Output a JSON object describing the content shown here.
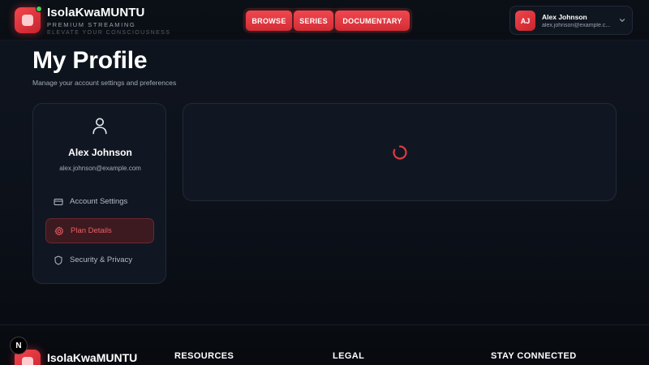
{
  "header": {
    "brand_name": "IsolaKwaMUNTU",
    "tagline_primary": "PREMIUM STREAMING",
    "tagline_secondary": "ELEVATE YOUR CONSCIOUSNESS",
    "status_dot_color": "#39d353",
    "nav": [
      {
        "label": "BROWSE"
      },
      {
        "label": "SERIES"
      },
      {
        "label": "DOCUMENTARY"
      }
    ],
    "user": {
      "initials": "AJ",
      "name": "Alex Johnson",
      "email": "alex.johnson@example.c..."
    }
  },
  "page": {
    "title": "My Profile",
    "subtitle": "Manage your account settings and preferences"
  },
  "sidebar": {
    "name": "Alex Johnson",
    "email": "alex.johnson@example.com",
    "items": [
      {
        "label": "Account Settings",
        "icon": "credit-card-icon",
        "active": false
      },
      {
        "label": "Plan Details",
        "icon": "gear-icon",
        "active": true
      },
      {
        "label": "Security & Privacy",
        "icon": "shield-icon",
        "active": false
      }
    ]
  },
  "content": {
    "state": "loading",
    "spinner_icon": "loading-spinner-icon"
  },
  "footer": {
    "badge": "N",
    "brand_name": "IsolaKwaMUNTU",
    "headings": [
      "RESOURCES",
      "LEGAL",
      "STAY CONNECTED"
    ]
  },
  "colors": {
    "accent": "#e23a42",
    "background": "#0c111a",
    "card": "#111722",
    "active_item_bg": "#3c1a1f",
    "active_item_text": "#f05e66"
  }
}
